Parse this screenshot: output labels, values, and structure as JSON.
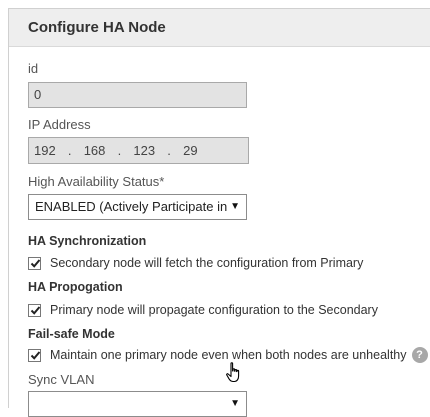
{
  "panel": {
    "title": "Configure HA Node"
  },
  "fields": {
    "id": {
      "label": "id",
      "value": "0"
    },
    "ip": {
      "label": "IP Address",
      "octets": [
        "192",
        "168",
        "123",
        "29"
      ],
      "separator": "."
    },
    "ha_status": {
      "label": "High Availability Status*",
      "value": "ENABLED (Actively Participate in"
    },
    "sync_vlan": {
      "label": "Sync VLAN",
      "value": ""
    }
  },
  "sections": {
    "sync": {
      "title": "HA Synchronization",
      "checkbox_label": "Secondary node will fetch the configuration from Primary",
      "checked": true
    },
    "propagation": {
      "title": "HA Propogation",
      "checkbox_label": "Primary node will propagate configuration to the Secondary",
      "checked": true
    },
    "failsafe": {
      "title": "Fail-safe Mode",
      "checkbox_label": "Maintain one primary node even when both nodes are unhealthy",
      "checked": true,
      "help": "?"
    }
  },
  "icons": {
    "dropdown": "triangle-down-icon",
    "check": "checkmark-icon",
    "help": "question-circle-icon",
    "cursor": "hand-pointer-icon"
  }
}
